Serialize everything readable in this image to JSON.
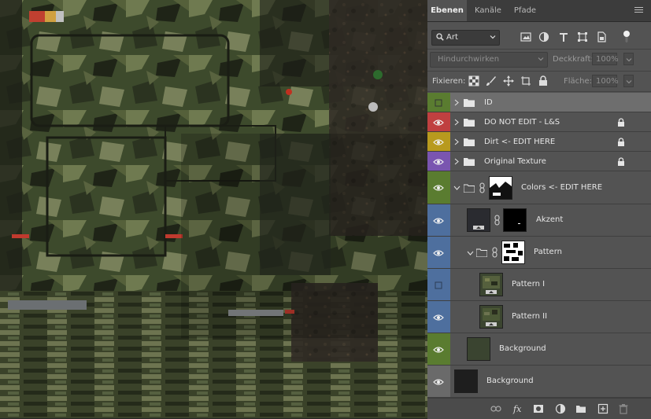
{
  "colors": {
    "vis_default": "#5a7c30",
    "vis_red": "#c04040",
    "vis_yellow": "#b89a1e",
    "vis_purple": "#7a55b0",
    "vis_blue": "#4e6f9e",
    "vis_gray": "#6a6a6a"
  },
  "tabs": [
    {
      "label": "Ebenen",
      "active": true
    },
    {
      "label": "Kanäle",
      "active": false
    },
    {
      "label": "Pfade",
      "active": false
    }
  ],
  "filter": {
    "kind_label": "Art",
    "icons": [
      "image-filter-icon",
      "adjustment-filter-icon",
      "type-filter-icon",
      "shape-filter-icon",
      "smart-object-filter-icon"
    ]
  },
  "blend": {
    "mode": "Hindurchwirken",
    "opacity_label": "Deckkraft:",
    "opacity_value": "100%"
  },
  "lock": {
    "label": "Fixieren:",
    "fill_label": "Fläche:",
    "fill_value": "100%"
  },
  "layers": [
    {
      "name": "ID",
      "type": "group",
      "visible": false,
      "color": "vis_default",
      "locked": false,
      "selected": true
    },
    {
      "name": "DO NOT EDIT  - L&S",
      "type": "group",
      "visible": true,
      "color": "vis_red",
      "locked": true
    },
    {
      "name": "Dirt <- EDIT HERE",
      "type": "group",
      "visible": true,
      "color": "vis_yellow",
      "locked": true
    },
    {
      "name": "Original Texture",
      "type": "group",
      "visible": true,
      "color": "vis_purple",
      "locked": true
    },
    {
      "name": "Colors <- EDIT HERE",
      "type": "group-mask",
      "visible": true,
      "color": "vis_default",
      "expanded": true
    },
    {
      "name": "Akzent",
      "type": "fill-mask",
      "visible": true,
      "color": "vis_blue"
    },
    {
      "name": "Pattern",
      "type": "group-mask",
      "visible": true,
      "color": "vis_blue",
      "expanded": true
    },
    {
      "name": "Pattern I",
      "type": "pattern",
      "visible": false,
      "color": "vis_blue"
    },
    {
      "name": "Pattern II",
      "type": "pattern",
      "visible": true,
      "color": "vis_blue"
    },
    {
      "name": "Background",
      "type": "fill",
      "visible": true,
      "color": "vis_default"
    },
    {
      "name": "Background",
      "type": "fill",
      "visible": true,
      "color": "vis_gray"
    }
  ],
  "footer_icons": [
    "link-layers-icon",
    "fx-icon",
    "add-mask-icon",
    "adjustment-layer-icon",
    "new-group-icon",
    "new-layer-icon",
    "delete-layer-icon"
  ]
}
